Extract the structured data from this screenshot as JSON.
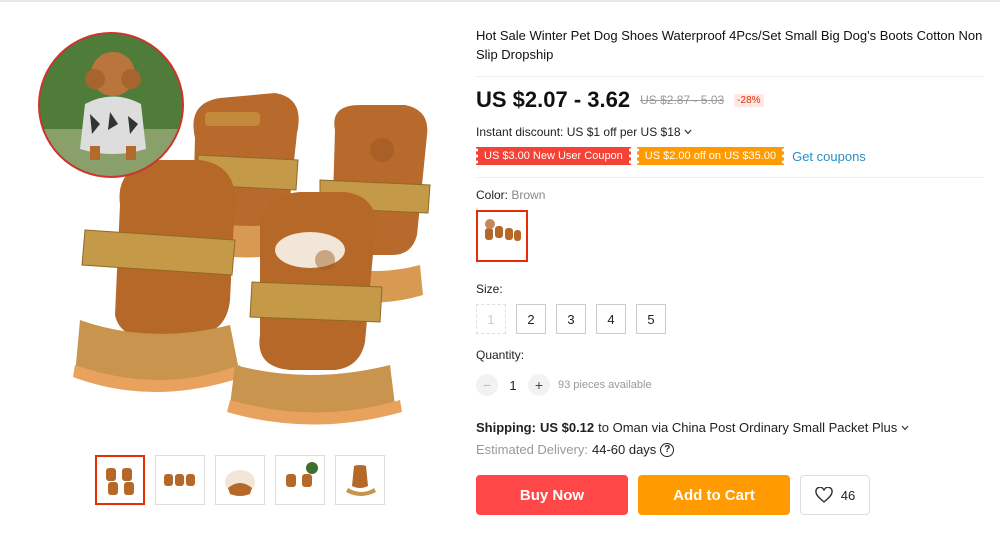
{
  "product": {
    "title": "Hot Sale Winter Pet Dog Shoes Waterproof 4Pcs/Set Small Big Dog's Boots Cotton Non Slip Dropship"
  },
  "price": {
    "current": "US $2.07 - 3.62",
    "original": "US $2.87 - 5.03",
    "discount": "-28%"
  },
  "instant_discount": "Instant discount: US $1 off per US $18",
  "coupons": {
    "new_user": "US $3.00 New User Coupon",
    "off": "US $2.00 off on US $35.00",
    "get_label": "Get coupons"
  },
  "color": {
    "label": "Color:",
    "selected": "Brown",
    "swatch_icon": "boots-thumbnail"
  },
  "size": {
    "label": "Size:",
    "options": [
      "1",
      "2",
      "3",
      "4",
      "5"
    ],
    "disabled": [
      "1"
    ]
  },
  "quantity": {
    "label": "Quantity:",
    "value": "1",
    "minus": "−",
    "plus": "+",
    "available": "93 pieces available"
  },
  "shipping": {
    "label": "Shipping:",
    "cost": "US $0.12",
    "route": "to Oman via China Post Ordinary Small Packet Plus"
  },
  "delivery": {
    "label": "Estimated Delivery:",
    "value": "44-60 days",
    "help_icon": "?"
  },
  "actions": {
    "buy_now": "Buy Now",
    "add_to_cart": "Add to Cart",
    "wishlist_count": "46"
  },
  "colors": {
    "accent_red": "#ff4747",
    "accent_orange": "#ff9a00",
    "link_blue": "#2a8fc4",
    "selected_border": "#e62e04"
  }
}
